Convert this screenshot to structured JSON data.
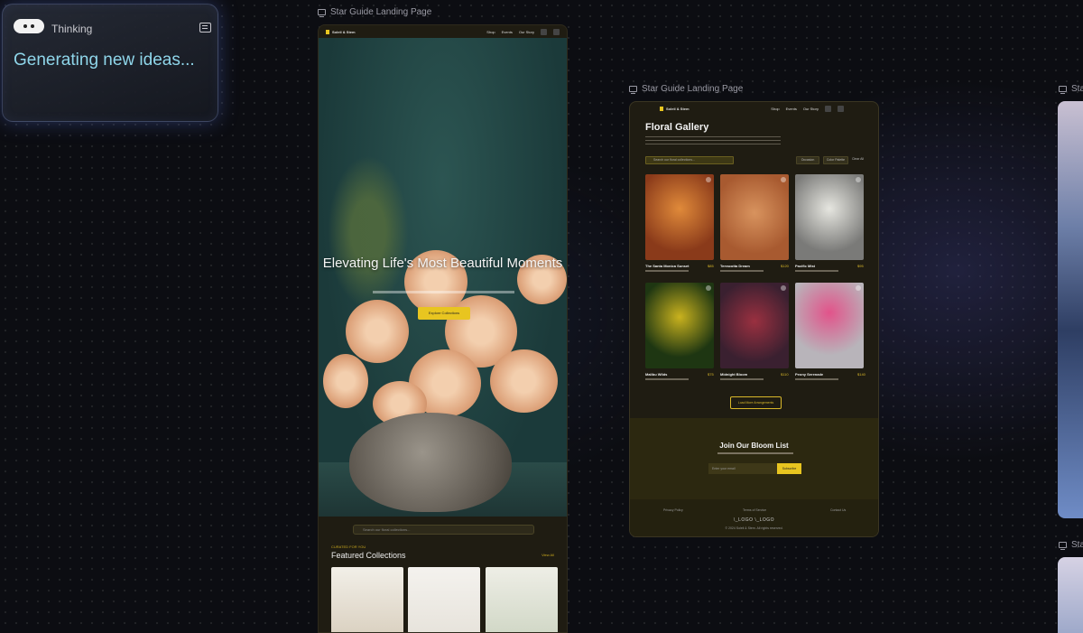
{
  "thinking_panel": {
    "title": "Thinking",
    "status": "Generating new ideas..."
  },
  "frames": {
    "label": "Star Guide Landing Page",
    "partial_label": "Sta"
  },
  "hero_page": {
    "brand": "Soleil & Stem",
    "nav_links": [
      "Shop",
      "Events",
      "Our Story"
    ],
    "headline": "Elevating Life's Most Beautiful Moments",
    "cta": "Explore Collections",
    "search_placeholder": "Search our floral collections...",
    "featured_kicker": "CURATED FOR YOU",
    "featured_title": "Featured Collections",
    "featured_link": "View All"
  },
  "gallery_page": {
    "brand": "Soleil & Stem",
    "nav_links": [
      "Shop",
      "Events",
      "Our Story"
    ],
    "title": "Floral Gallery",
    "search_placeholder": "Search our floral collections...",
    "filters": [
      "Occasion",
      "Color Palette"
    ],
    "clear_label": "Clear All",
    "products": [
      {
        "name": "The Santa Monica Sunset",
        "price": "$85",
        "color": "#c0602a"
      },
      {
        "name": "Terracotta Dream",
        "price": "$120",
        "color": "#b46a40"
      },
      {
        "name": "Pacific Mist",
        "price": "$95",
        "color": "#8c8c8a"
      },
      {
        "name": "Malibu Wilds",
        "price": "$75",
        "color": "#2d4a1e"
      },
      {
        "name": "Midnight Bloom",
        "price": "$110",
        "color": "#4a2a3a"
      },
      {
        "name": "Peony Serenade",
        "price": "$140",
        "color": "#b0aeb2"
      }
    ],
    "more_button": "Load More Arrangements",
    "newsletter_title": "Join Our Bloom List",
    "email_placeholder": "Enter your email",
    "subscribe_button": "Subscribe",
    "footer_links": [
      "Privacy Policy",
      "Terms of Service",
      "Contact Us"
    ],
    "footer_logos": "\\_LOGO \\_LOGO",
    "copyright": "© 2024 Soleil & Stem. All rights reserved."
  },
  "colors": {
    "accent": "#e8c520",
    "status_text": "#8fd6ea"
  }
}
